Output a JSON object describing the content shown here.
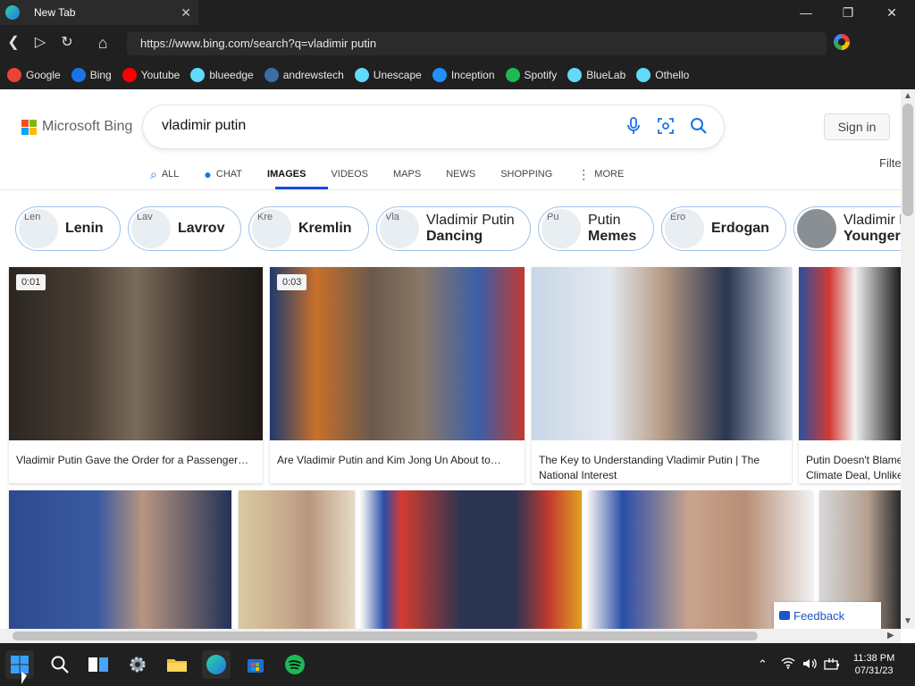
{
  "window": {
    "tab_title": "New Tab",
    "minimize": "—",
    "restore": "❐",
    "close": "✕"
  },
  "browser": {
    "url": "https://www.bing.com/search?q=vladimir putin"
  },
  "bookmarks": [
    {
      "label": "Google",
      "icon": "google-icon",
      "color": "#ea4335"
    },
    {
      "label": "Bing",
      "icon": "bing-icon",
      "color": "#1b73e8"
    },
    {
      "label": "Youtube",
      "icon": "youtube-icon",
      "color": "#ff0000"
    },
    {
      "label": "blueedge",
      "icon": "react-icon",
      "color": "#61dafb"
    },
    {
      "label": "andrewstech",
      "icon": "andrewstech-icon",
      "color": "#3b6ea5"
    },
    {
      "label": "Unescape",
      "icon": "react-icon",
      "color": "#61dafb"
    },
    {
      "label": "Inception",
      "icon": "inception-icon",
      "color": "#1e90ff"
    },
    {
      "label": "Spotify",
      "icon": "spotify-icon",
      "color": "#1db954"
    },
    {
      "label": "BlueLab",
      "icon": "react-icon",
      "color": "#61dafb"
    },
    {
      "label": "Othello",
      "icon": "react-icon",
      "color": "#61dafb"
    }
  ],
  "bing": {
    "logo_text": "Microsoft Bing",
    "query": "vladimir putin",
    "sign_in": "Sign in",
    "filter": "Filte",
    "nav": [
      "ALL",
      "CHAT",
      "IMAGES",
      "VIDEOS",
      "MAPS",
      "NEWS",
      "SHOPPING",
      "MORE"
    ]
  },
  "chips": [
    {
      "alt": "Len",
      "line1": "Lenin",
      "line2": ""
    },
    {
      "alt": "Lav",
      "line1": "Lavrov",
      "line2": ""
    },
    {
      "alt": "Kre",
      "line1": "Kremlin",
      "line2": ""
    },
    {
      "alt": "Vla",
      "line1": "Vladimir Putin",
      "line2": "Dancing"
    },
    {
      "alt": "Pu",
      "line1": "Putin",
      "line2": "Memes"
    },
    {
      "alt": "Ero",
      "line1": "Erdogan",
      "line2": ""
    },
    {
      "alt": "",
      "line1": "Vladimir P",
      "line2": "Younger"
    }
  ],
  "results_row1": [
    {
      "duration": "0:01",
      "caption1": "Vladimir Putin Gave the Order for a Passenger…",
      "caption2": ""
    },
    {
      "duration": "0:03",
      "caption1": "Are Vladimir Putin and Kim Jong Un About to…",
      "caption2": ""
    },
    {
      "duration": "",
      "caption1": "The Key to Understanding Vladimir Putin | The",
      "caption2": "National Interest"
    },
    {
      "duration": "",
      "caption1": "Putin Doesn't Blame",
      "caption2": "Climate Deal, Unlike"
    }
  ],
  "feedback": "Feedback",
  "clock": {
    "time": "11:38 PM",
    "date": "07/31/23"
  }
}
